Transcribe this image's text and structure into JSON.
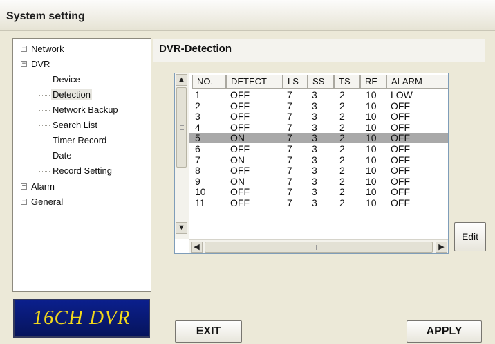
{
  "window": {
    "title": "System setting"
  },
  "tree": {
    "items": [
      {
        "label": "Network",
        "toggle": "+"
      },
      {
        "label": "DVR",
        "toggle": "−"
      },
      {
        "label": "Device"
      },
      {
        "label": "Detection"
      },
      {
        "label": "Network Backup"
      },
      {
        "label": "Search List"
      },
      {
        "label": "Timer Record"
      },
      {
        "label": "Date"
      },
      {
        "label": "Record Setting"
      },
      {
        "label": "Alarm",
        "toggle": "+"
      },
      {
        "label": "General",
        "toggle": "+"
      }
    ]
  },
  "logo": {
    "text": "16CH DVR"
  },
  "section": {
    "title": "DVR-Detection"
  },
  "grid": {
    "columns": [
      "NO.",
      "DETECT",
      "LS",
      "SS",
      "TS",
      "RE",
      "ALARM"
    ],
    "rows": [
      [
        "1",
        "OFF",
        "7",
        "3",
        "2",
        "10",
        "LOW"
      ],
      [
        "2",
        "OFF",
        "7",
        "3",
        "2",
        "10",
        "OFF"
      ],
      [
        "3",
        "OFF",
        "7",
        "3",
        "2",
        "10",
        "OFF"
      ],
      [
        "4",
        "OFF",
        "7",
        "3",
        "2",
        "10",
        "OFF"
      ],
      [
        "5",
        "ON",
        "7",
        "3",
        "2",
        "10",
        "OFF"
      ],
      [
        "6",
        "OFF",
        "7",
        "3",
        "2",
        "10",
        "OFF"
      ],
      [
        "7",
        "ON",
        "7",
        "3",
        "2",
        "10",
        "OFF"
      ],
      [
        "8",
        "OFF",
        "7",
        "3",
        "2",
        "10",
        "OFF"
      ],
      [
        "9",
        "ON",
        "7",
        "3",
        "2",
        "10",
        "OFF"
      ],
      [
        "10",
        "OFF",
        "7",
        "3",
        "2",
        "10",
        "OFF"
      ],
      [
        "11",
        "OFF",
        "7",
        "3",
        "2",
        "10",
        "OFF"
      ]
    ],
    "selected_row": "5"
  },
  "buttons": {
    "edit": "Edit",
    "exit": "EXIT",
    "apply": "APPLY"
  },
  "colors": {
    "selected_row": "#a9a9a9",
    "logo_bg": "#0b1f8c",
    "logo_text": "#f2d81a"
  }
}
